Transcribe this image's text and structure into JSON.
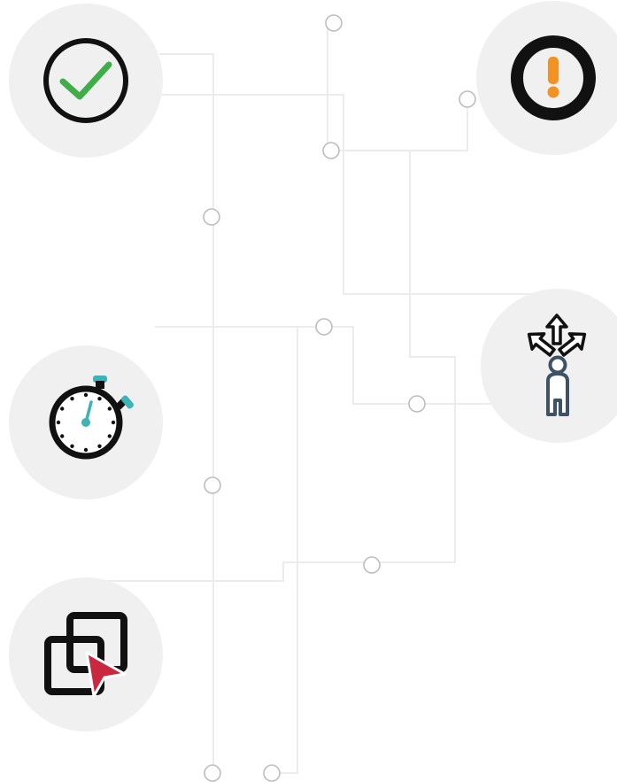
{
  "diagram": {
    "type": "connector-network",
    "icons": [
      {
        "name": "checkmark-icon",
        "accent": "#3fae49"
      },
      {
        "name": "exclamation-icon",
        "accent": "#f29222"
      },
      {
        "name": "stopwatch-icon",
        "accent": "#3bb3b8"
      },
      {
        "name": "person-directions-icon",
        "accent": "#3d5266"
      },
      {
        "name": "window-cursor-icon",
        "accent": "#c9283e"
      }
    ],
    "colors": {
      "bubble": "#f0f0f0",
      "connector": "#ececec",
      "node_stroke": "#bdbdbd",
      "outline": "#111111"
    }
  }
}
